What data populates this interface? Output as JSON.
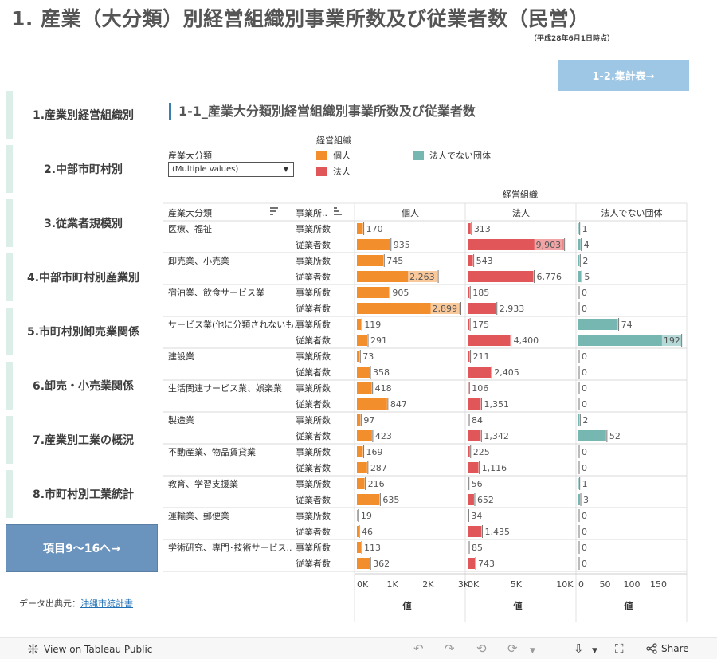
{
  "header": {
    "title": "1. 産業（大分類）別経営組織別事業所数及び従業者数（民営）",
    "subtitle": "（平成28年6月1日時点）",
    "tally_button": "1-2.集計表→"
  },
  "sidebar": {
    "items": [
      {
        "label": "1.産業別経営組織別"
      },
      {
        "label": "2.中部市町村別"
      },
      {
        "label": "3.従業者規模別"
      },
      {
        "label": "4.中部市町村別産業別"
      },
      {
        "label": "5.市町村別卸売業関係"
      },
      {
        "label": "6.卸売・小売業関係"
      },
      {
        "label": "7.産業別工業の概況"
      },
      {
        "label": "8.市町村別工業統計"
      }
    ],
    "next_button": "項目9〜16へ→",
    "source_prefix": "データ出典元：",
    "source_link": "沖縄市統計書"
  },
  "chart_title": "1-1_産業大分類別経営組織別事業所数及び従業者数",
  "filter": {
    "label": "産業大分類",
    "value": "(Multiple values)"
  },
  "legend": {
    "title": "経営組織",
    "items": [
      {
        "label": "個人",
        "color": "#f28e2b"
      },
      {
        "label": "法人",
        "color": "#e15759"
      },
      {
        "label": "法人でない団体",
        "color": "#76b7b2"
      }
    ]
  },
  "toolbar": {
    "view_label": "View on Tableau Public",
    "share_label": "Share"
  },
  "chart_data": {
    "type": "bar",
    "column_group_header": "経営組織",
    "row_header_1": "産業大分類",
    "row_header_2": "事業所..",
    "measure_label": "値",
    "panels": [
      {
        "name": "個人",
        "color": "#f28e2b",
        "highlight_color": "#f9c89b",
        "max": 3000,
        "ticks": [
          0,
          1000,
          2000,
          3000
        ],
        "tick_labels": [
          "0K",
          "1K",
          "2K",
          "3K"
        ]
      },
      {
        "name": "法人",
        "color": "#e15759",
        "highlight_color": "#f1a4a5",
        "max": 11000,
        "ticks": [
          0,
          5000,
          10000
        ],
        "tick_labels": [
          "0K",
          "5K",
          "10K"
        ]
      },
      {
        "name": "法人でない団体",
        "color": "#76b7b2",
        "highlight_color": "#b5d9d6",
        "max": 200,
        "ticks": [
          0,
          50,
          100,
          150
        ],
        "tick_labels": [
          "0",
          "50",
          "100",
          "150"
        ]
      }
    ],
    "measures": [
      "事業所数",
      "従業者数"
    ],
    "industries": [
      {
        "name": "医療、福祉",
        "values": [
          [
            170,
            935
          ],
          [
            313,
            9903
          ],
          [
            1,
            4
          ]
        ]
      },
      {
        "name": "卸売業、小売業",
        "values": [
          [
            745,
            2263
          ],
          [
            543,
            6776
          ],
          [
            2,
            5
          ]
        ]
      },
      {
        "name": "宿泊業、飲食サービス業",
        "values": [
          [
            905,
            2899
          ],
          [
            185,
            2933
          ],
          [
            0,
            0
          ]
        ]
      },
      {
        "name": "サービス業(他に分類されないも..",
        "values": [
          [
            119,
            291
          ],
          [
            175,
            4400
          ],
          [
            74,
            192
          ]
        ]
      },
      {
        "name": "建設業",
        "values": [
          [
            73,
            358
          ],
          [
            211,
            2405
          ],
          [
            0,
            0
          ]
        ]
      },
      {
        "name": "生活関連サービス業、娯楽業",
        "values": [
          [
            418,
            847
          ],
          [
            106,
            1351
          ],
          [
            0,
            0
          ]
        ]
      },
      {
        "name": "製造業",
        "values": [
          [
            97,
            423
          ],
          [
            84,
            1342
          ],
          [
            2,
            52
          ]
        ]
      },
      {
        "name": "不動産業、物品賃貸業",
        "values": [
          [
            169,
            287
          ],
          [
            225,
            1116
          ],
          [
            0,
            0
          ]
        ]
      },
      {
        "name": "教育、学習支援業",
        "values": [
          [
            216,
            635
          ],
          [
            56,
            652
          ],
          [
            1,
            3
          ]
        ]
      },
      {
        "name": "運輸業、郵便業",
        "values": [
          [
            19,
            46
          ],
          [
            34,
            1435
          ],
          [
            0,
            0
          ]
        ]
      },
      {
        "name": "学術研究、専門･技術サービス..",
        "values": [
          [
            113,
            362
          ],
          [
            85,
            743
          ],
          [
            0,
            0
          ]
        ]
      }
    ]
  }
}
